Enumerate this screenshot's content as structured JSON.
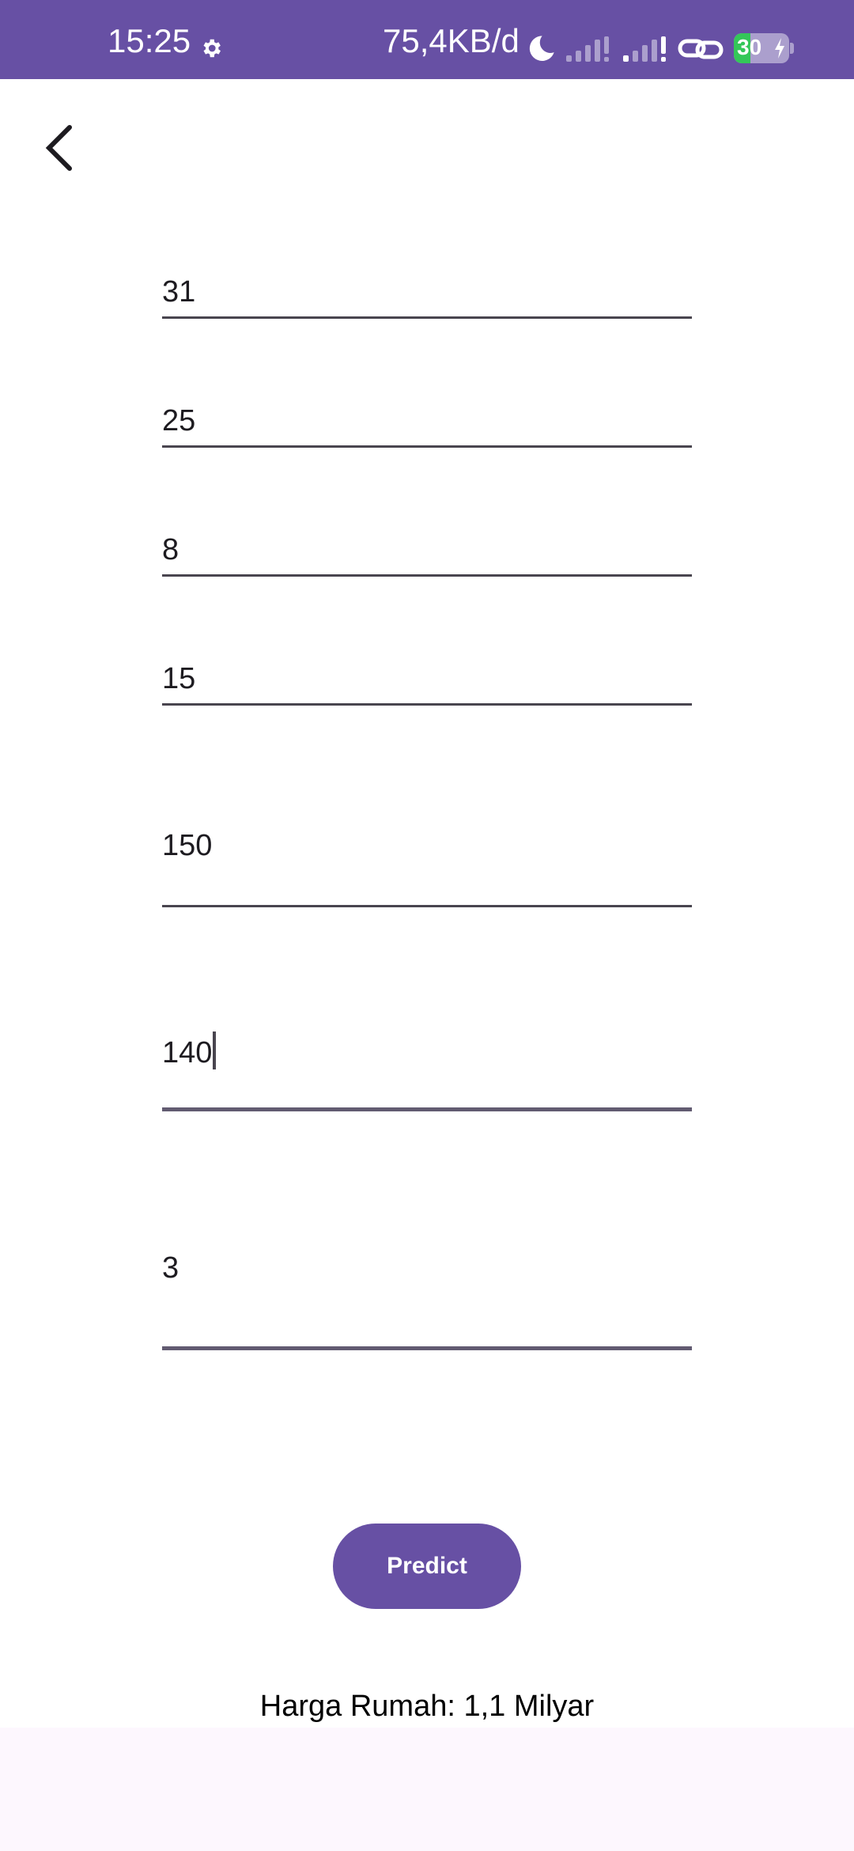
{
  "status_bar": {
    "time": "15:25",
    "net_speed": "75,4KB/d",
    "battery_level": "30",
    "battery_fraction": 0.3,
    "icons": [
      "gear-icon",
      "moon-icon",
      "signal-icon",
      "signal-icon",
      "link-icon",
      "battery-icon"
    ],
    "bar_color": "#6750a4"
  },
  "nav": {
    "back_icon": "chevron-left-icon"
  },
  "form": {
    "fields": [
      {
        "value": "31"
      },
      {
        "value": "25"
      },
      {
        "value": "8"
      },
      {
        "value": "15"
      },
      {
        "value": "150"
      },
      {
        "value": "140",
        "focused": true
      },
      {
        "value": "3"
      }
    ]
  },
  "predict_button": {
    "label": "Predict",
    "color": "#6750a4"
  },
  "result": {
    "text": "Harga Rumah: 1,1 Milyar"
  }
}
